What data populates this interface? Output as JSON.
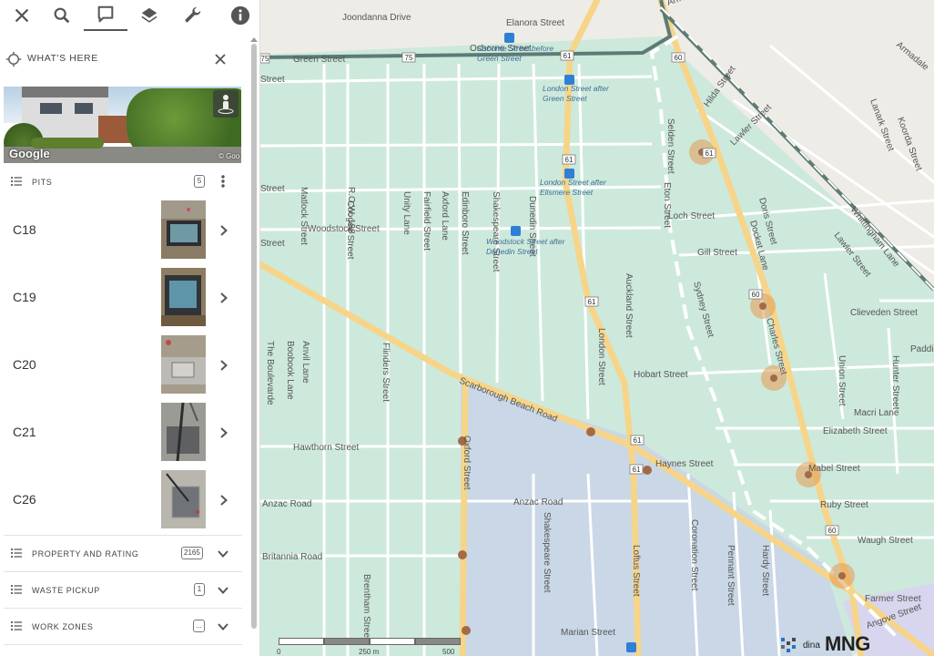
{
  "toolbar": {
    "items": [
      "close-icon",
      "search-icon",
      "comment-icon",
      "layers-icon",
      "wrench-icon",
      "info-icon"
    ],
    "active": "comment-icon"
  },
  "whats_here": {
    "title": "WHAT'S HERE"
  },
  "street_view": {
    "brand": "Google",
    "copyright": "© Goo"
  },
  "pits": {
    "label": "PITS",
    "count": "5",
    "items": [
      {
        "name": "C18"
      },
      {
        "name": "C19"
      },
      {
        "name": "C20"
      },
      {
        "name": "C21"
      },
      {
        "name": "C26"
      }
    ]
  },
  "sections": [
    {
      "label": "PROPERTY AND RATING",
      "count": "2165"
    },
    {
      "label": "WASTE PICKUP",
      "count": "1"
    },
    {
      "label": "WORK ZONES",
      "count": "..."
    }
  ],
  "map": {
    "colors": {
      "base": "#eeece6",
      "overlay": "#cde9dc",
      "blue_overlay": "#c9d7e6",
      "main_road": "#f6d58a",
      "route_line": "#5d7b76",
      "pit_marker": "#e59a50",
      "pit_center": "#a46a48"
    },
    "streets": [
      "Joondanna Drive",
      "Elanora Street",
      "Osborne Street",
      "Green Street",
      "Armadale Crescent",
      "Hilda Street",
      "Lawler Street",
      "Matlock Street",
      "R.O.W. 188",
      "Coogee Street",
      "Unity Lane",
      "Fairfield Street",
      "Axford Lane",
      "Edinboro Street",
      "Shakespeare Street",
      "Dunedin Street",
      "Selden Street",
      "Eton Street",
      "Loch Street",
      "Woodstock Street",
      "Doris Street",
      "Docket Lane",
      "Gill Street",
      "Whittingham Lane",
      "Lawler Street",
      "Sydney Street",
      "Clieveden Street",
      "Charles Street",
      "Hobart Street",
      "Union Street",
      "Hunter Street",
      "Macri Lane",
      "Elizabeth Street",
      "Scarborough Beach Road",
      "Haynes Street",
      "Mabel Street",
      "Hawthorn Street",
      "Anzac Road",
      "Anzac Road",
      "Ruby Street",
      "Waugh Street",
      "Britannia Road",
      "Oxford Street",
      "Shakespeare Street",
      "Loftus Street",
      "Coronation Street",
      "Pennant Street",
      "Hardy Street",
      "Farmer Street",
      "Marian Street",
      "Angove Street",
      "The Boulevarde",
      "Boobook Lane",
      "Anvil Lane",
      "Flinders Street",
      "Brentham Street",
      "Auckland Street",
      "London Street",
      "Street",
      "Street",
      "Street",
      "Paddin",
      "Lanark Street",
      "Koorda Street",
      "Armadale"
    ],
    "bus_stops": [
      "Osborne Street before Green Street",
      "London Street after Green Street",
      "London Street after Ellsmere Street",
      "Woodstock Street after Dunedin Street"
    ],
    "route_shields": [
      "61",
      "60",
      "61",
      "61",
      "61",
      "61",
      "60",
      "60",
      "75",
      "75",
      "61"
    ],
    "scale": {
      "labels": [
        "0",
        "250 m",
        "500 m"
      ]
    },
    "logo": {
      "text": "MNG",
      "prefix": "dina"
    }
  }
}
